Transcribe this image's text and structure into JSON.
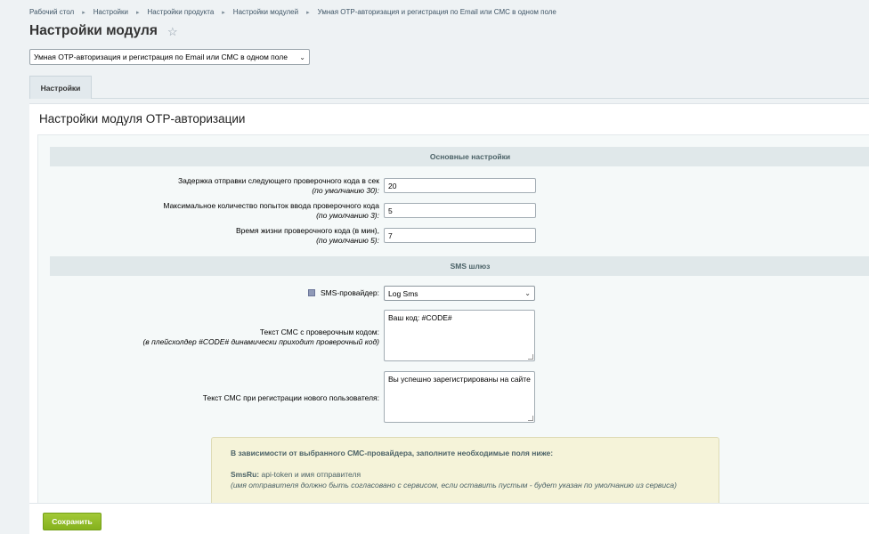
{
  "breadcrumb": [
    "Рабочий стол",
    "Настройки",
    "Настройки продукта",
    "Настройки модулей",
    "Умная OTP-авторизация и регистрация по Email или СМС в одном поле"
  ],
  "page": {
    "title": "Настройки модуля",
    "module_select": "Умная OTP-авторизация и регистрация по Email или СМС в одном поле"
  },
  "tabs": [
    {
      "label": "Настройки"
    }
  ],
  "panel": {
    "title": "Настройки модуля OTP-авторизации",
    "sections": {
      "main": "Основные настройки",
      "sms": "SMS шлюз"
    },
    "fields": {
      "delay": {
        "label": "Задержка отправки следующего проверочного кода в сек",
        "hint": "(по умолчанию 30):",
        "value": "20"
      },
      "attempts": {
        "label": "Максимальное количество попыток ввода проверочного кода",
        "hint": "(по умолчанию 3):",
        "value": "5"
      },
      "lifetime": {
        "label": "Время жизни проверочного кода (в мин),",
        "hint": "(по умолчанию 5):",
        "value": "7"
      },
      "provider": {
        "label": "SMS-провайдер:",
        "value": "Log Sms"
      },
      "sms_text": {
        "label": "Текст СМС с проверочным кодом:",
        "hint": "(в плейсхолдер #CODE# динамически приходит проверочный код)",
        "value": "Ваш код: #CODE#"
      },
      "reg_text": {
        "label": "Текст СМС при регистрации нового пользователя:",
        "value": "Вы успешно зарегистрированы на сайте"
      }
    },
    "note": {
      "heading": "В зависимости от выбранного СМС-провайдера, заполните необходимые поля ниже:",
      "provider_name": "SmsRu:",
      "provider_desc": "api-token и имя отправителя",
      "provider_hint": "(имя отправителя должно быть согласовано с сервисом, если оставить пустым - будет указан по умолчанию из сервиса)"
    }
  },
  "footer": {
    "save_label": "Сохранить"
  },
  "colors": {
    "accent_green": "#85b11d",
    "section_bg": "#e0e8ea",
    "note_bg": "#f5f3d9"
  }
}
